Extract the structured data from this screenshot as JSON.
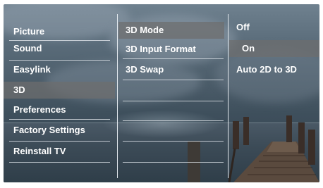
{
  "menu": {
    "level1": [
      {
        "label": "Picture",
        "selected": false
      },
      {
        "label": "Sound",
        "selected": false
      },
      {
        "label": "Easylink",
        "selected": false
      },
      {
        "label": "3D",
        "selected": true
      },
      {
        "label": "Preferences",
        "selected": false
      },
      {
        "label": "Factory Settings",
        "selected": false
      },
      {
        "label": "Reinstall TV",
        "selected": false
      }
    ],
    "level2": [
      {
        "label": "3D Mode",
        "selected": true
      },
      {
        "label": "3D Input Format",
        "selected": false
      },
      {
        "label": "3D Swap",
        "selected": false
      }
    ],
    "level3": [
      {
        "label": "Off",
        "selected": false
      },
      {
        "label": "On",
        "selected": true
      },
      {
        "label": "Auto 2D to 3D",
        "selected": false
      }
    ]
  }
}
